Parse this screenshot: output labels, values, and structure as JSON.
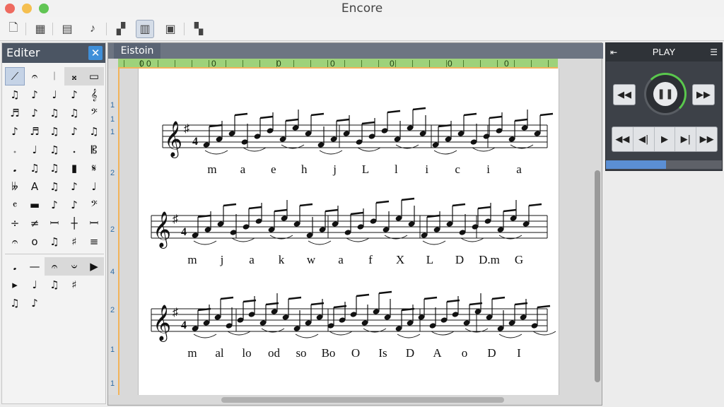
{
  "window": {
    "title": "Encore"
  },
  "toolbar": {
    "buttons": [
      {
        "name": "new-document-icon",
        "glyph": "🗋"
      },
      {
        "name": "save-icon",
        "glyph": "▦"
      },
      {
        "name": "parts-icon",
        "glyph": "▤"
      },
      {
        "name": "playback-tools-icon",
        "glyph": "♪"
      },
      {
        "name": "palette-icon",
        "glyph": "▞"
      },
      {
        "name": "editor-icon",
        "glyph": "▥"
      },
      {
        "name": "score-setup-icon",
        "glyph": "▣"
      },
      {
        "name": "mixer-icon",
        "glyph": "▚"
      }
    ]
  },
  "editor_panel": {
    "title": "Editer",
    "close": "✕",
    "rows": [
      [
        "⟋",
        "𝄐",
        "𝄀",
        "𝄪",
        "▭"
      ],
      [
        "♫",
        "♪",
        "♩",
        "♪",
        "𝄞"
      ],
      [
        "♬",
        "♪",
        "♫",
        "♫",
        "𝄢"
      ],
      [
        "♪",
        "♬",
        "♫",
        "♪",
        "♫"
      ],
      [
        "𝆹",
        "♩",
        "♫",
        "𝆺",
        "𝄡"
      ],
      [
        "𝅘",
        "♫",
        "♫",
        "▮",
        "𝄋"
      ],
      [
        "𝄫",
        "A",
        "♫",
        "♪",
        "♩"
      ],
      [
        "𝄴",
        "▬",
        "♪",
        "♪",
        "𝄢"
      ],
      [
        "÷",
        "≠",
        "𝄩",
        "┼",
        "𝄩"
      ],
      [
        "𝄐",
        "o",
        "♫",
        "♯",
        "≡"
      ]
    ],
    "rows2": [
      [
        "𝅘",
        "—",
        "𝄐",
        "𝄑",
        "▶"
      ],
      [
        "▸",
        "♩",
        "♫",
        "♯",
        ""
      ],
      [
        "♫",
        "♪",
        "",
        "",
        ""
      ]
    ]
  },
  "document": {
    "tab": "Eistoin",
    "ruler_marks": [
      "0",
      "0",
      "0",
      "0",
      "0",
      "0",
      "0",
      "0"
    ],
    "vruler": [
      "1",
      "1",
      "1",
      "2",
      "2",
      "4",
      "2",
      "1",
      "1"
    ],
    "lyrics": [
      [
        "m",
        "a",
        "e",
        "h",
        "j",
        "L",
        "l",
        "i",
        "c",
        "i",
        "a"
      ],
      [
        "m",
        "j",
        "a",
        "k",
        "w",
        "a",
        "f",
        "X",
        "L",
        "D",
        "D.m",
        "G"
      ],
      [
        "m",
        "al",
        "lo",
        "od",
        "so",
        "Bo",
        "O",
        "Is",
        "D",
        "A",
        "o",
        "D",
        "I"
      ]
    ]
  },
  "play_panel": {
    "title": "PLAY",
    "left_icon": "⇤",
    "menu_icon": "☰",
    "rewind": "◀◀",
    "pause": "❚❚",
    "forward": "▶▶",
    "transport": [
      "◀◀",
      "◀|",
      "▶",
      "▶|",
      "▶▶"
    ],
    "progress": 0.52
  }
}
